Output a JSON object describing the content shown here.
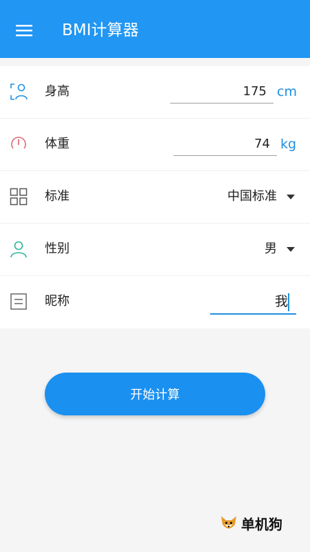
{
  "appbar": {
    "title": "BMI计算器",
    "icon": "menu-icon",
    "color": "#2196f3"
  },
  "form": {
    "height": {
      "label": "身高",
      "value": "175",
      "unit": "cm",
      "icon": "person-height-icon"
    },
    "weight": {
      "label": "体重",
      "value": "74",
      "unit": "kg",
      "icon": "gauge-icon"
    },
    "standard": {
      "label": "标准",
      "value": "中国标准",
      "icon": "grid-icon"
    },
    "gender": {
      "label": "性别",
      "value": "男",
      "icon": "person-icon"
    },
    "nickname": {
      "label": "昵称",
      "value": "我",
      "icon": "note-icon"
    }
  },
  "actions": {
    "calculate_label": "开始计算"
  },
  "watermark": {
    "text": "单机狗",
    "icon": "fox-logo-icon"
  },
  "colors": {
    "accent": "#1e8fe0",
    "button": "#1a90f0"
  }
}
